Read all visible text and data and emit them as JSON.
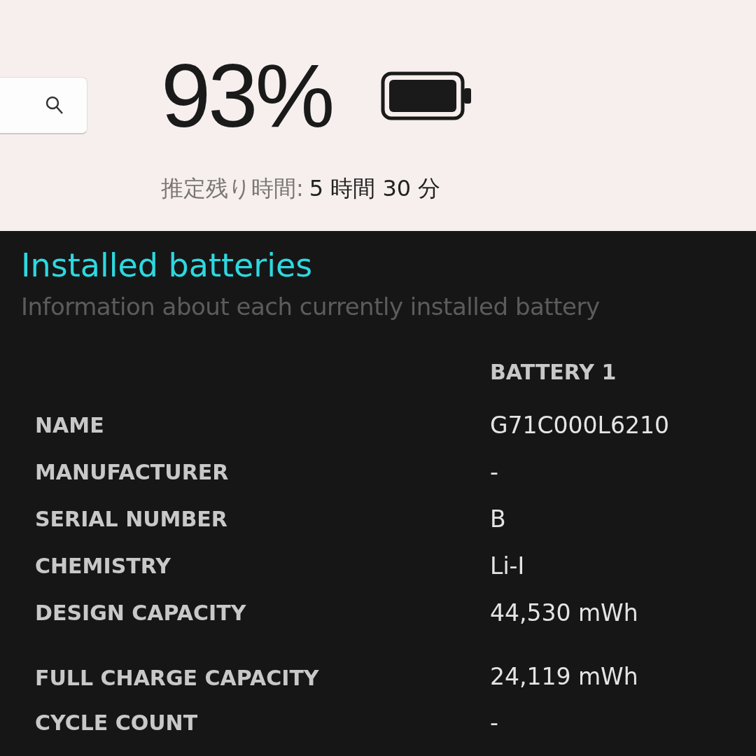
{
  "search": {
    "kind": "search"
  },
  "battery": {
    "percent": "93%",
    "remaining_label": "推定残り時間:",
    "remaining_value": "5 時間 30 分"
  },
  "installed": {
    "title": "Installed batteries",
    "subtitle": "Information about each currently installed battery",
    "column": "BATTERY 1",
    "rows": [
      {
        "label": "NAME",
        "value": "G71C000L6210"
      },
      {
        "label": "MANUFACTURER",
        "value": "-"
      },
      {
        "label": "SERIAL NUMBER",
        "value": "B"
      },
      {
        "label": "CHEMISTRY",
        "value": "Li-I"
      },
      {
        "label": "DESIGN CAPACITY",
        "value": "44,530 mWh"
      },
      {
        "label": "FULL CHARGE CAPACITY",
        "value": "24,119 mWh"
      },
      {
        "label": "CYCLE COUNT",
        "value": "-"
      }
    ]
  }
}
